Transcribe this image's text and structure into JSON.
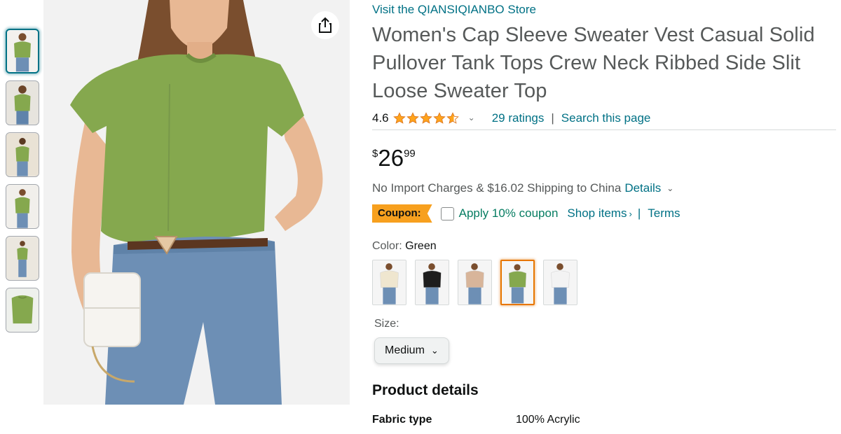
{
  "thumbnails": [
    {
      "name": "thumb-1",
      "selected": true
    },
    {
      "name": "thumb-2",
      "selected": false
    },
    {
      "name": "thumb-3",
      "selected": false
    },
    {
      "name": "thumb-4",
      "selected": false
    },
    {
      "name": "thumb-5",
      "selected": false
    },
    {
      "name": "thumb-6",
      "selected": false
    }
  ],
  "main_image": {
    "share_icon": "share-icon"
  },
  "product": {
    "store_link": "Visit the QIANSIQIANBO Store",
    "title": "Women's Cap Sleeve Sweater Vest Casual Solid Pullover Tank Tops Crew Neck Ribbed Side Slit Loose Sweater Top",
    "rating": "4.6",
    "rating_stars": 4.6,
    "ratings_link": "29 ratings",
    "separator": "|",
    "search_link": "Search this page",
    "price": {
      "symbol": "$",
      "whole": "26",
      "fraction": "99"
    },
    "shipping": {
      "text": "No Import Charges & $16.02 Shipping to China",
      "details_link": "Details"
    },
    "coupon": {
      "badge": "Coupon:",
      "apply_text": "Apply 10% coupon",
      "shop_items": "Shop items",
      "shop_items_arrow": "›",
      "pipe": "|",
      "terms": "Terms"
    },
    "color": {
      "label": "Color:",
      "selected": "Green",
      "swatches": [
        {
          "name": "swatch-cream",
          "color": "#efe6cf"
        },
        {
          "name": "swatch-black",
          "color": "#1e1e1e"
        },
        {
          "name": "swatch-beige",
          "color": "#d8b59a"
        },
        {
          "name": "swatch-green",
          "color": "#85a84e"
        },
        {
          "name": "swatch-white",
          "color": "#f3f3f3"
        }
      ]
    },
    "size": {
      "label": "Size:",
      "selected": "Medium"
    },
    "details": {
      "title": "Product details",
      "rows": [
        {
          "key": "Fabric type",
          "value": "100% Acrylic"
        }
      ]
    }
  },
  "colors": {
    "link": "#007185",
    "coupon_badge": "#f7a01e",
    "coupon_text": "#067d62",
    "star": "#ffa41c",
    "sweater": "#85a84e"
  }
}
